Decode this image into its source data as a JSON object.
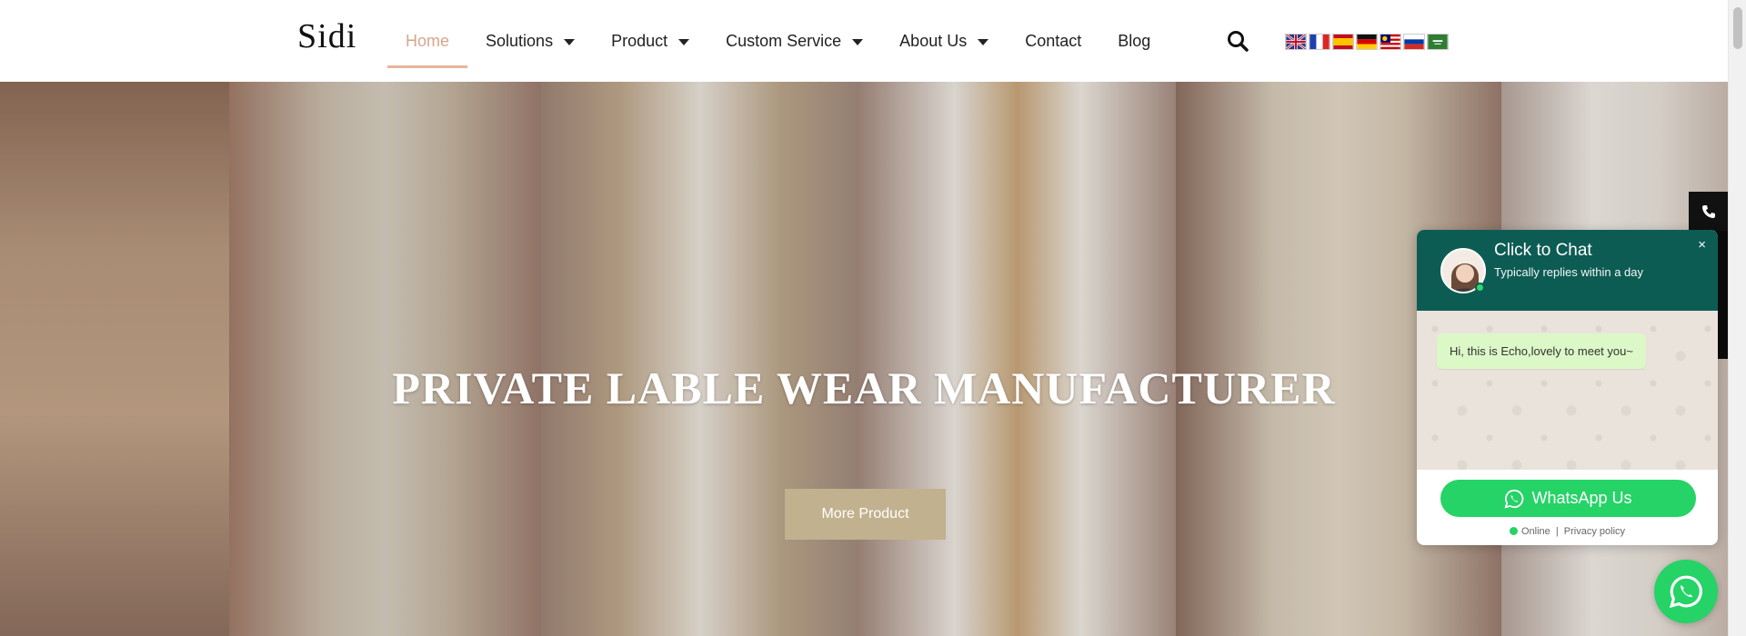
{
  "header": {
    "logo": "Sidi",
    "nav": [
      {
        "label": "Home",
        "active": true,
        "dropdown": false
      },
      {
        "label": "Solutions",
        "dropdown": true
      },
      {
        "label": "Product",
        "dropdown": true
      },
      {
        "label": "Custom Service",
        "dropdown": true
      },
      {
        "label": "About Us",
        "dropdown": true
      },
      {
        "label": "Contact",
        "dropdown": false
      },
      {
        "label": "Blog",
        "dropdown": false
      }
    ],
    "search_icon": "search-icon",
    "flags": [
      "uk-flag",
      "france-flag",
      "spain-flag",
      "germany-flag",
      "malaysia-flag",
      "russia-flag",
      "saudi-flag"
    ]
  },
  "hero": {
    "title": "PRIVATE LABLE WEAR MANUFACTURER",
    "button": "More Product"
  },
  "chat": {
    "title": "Click to Chat",
    "subtitle": "Typically replies within a day",
    "close": "×",
    "message": "Hi, this is Echo,lovely to meet you~",
    "button": "WhatsApp Us",
    "status": "Online",
    "separator": "|",
    "privacy": "Privacy policy"
  },
  "colors": {
    "accent": "#d8a58a",
    "button": "#c2b18e",
    "whatsapp_green": "#25d366",
    "chat_header": "#0d5c54"
  }
}
